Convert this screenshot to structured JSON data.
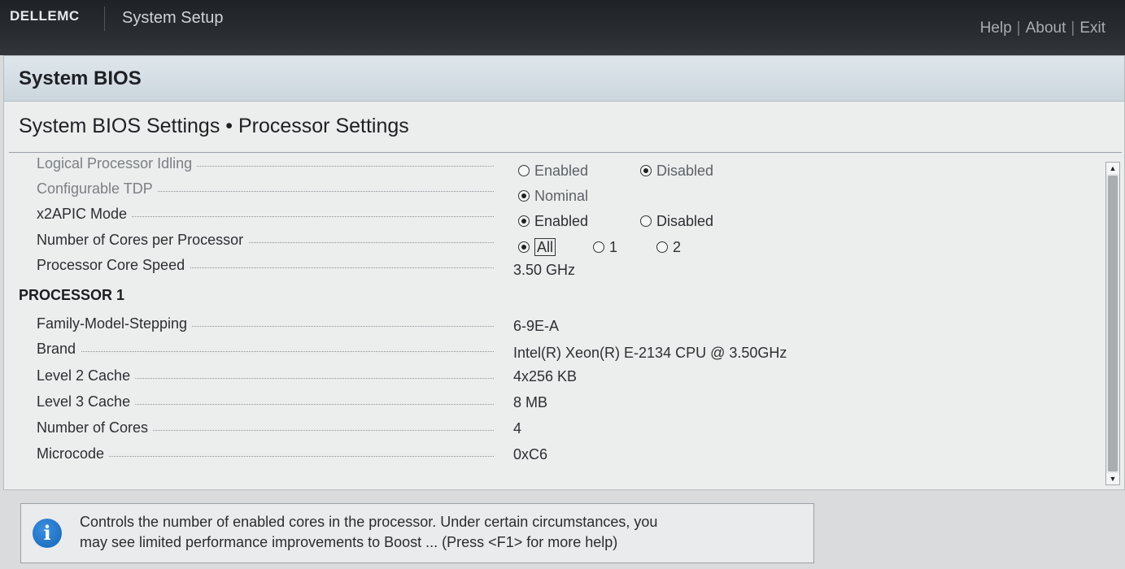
{
  "header": {
    "brand": "DELLEMC",
    "app_title": "System Setup",
    "links": [
      "Help",
      "About",
      "Exit"
    ]
  },
  "section": {
    "title": "System BIOS"
  },
  "page": {
    "title": "System BIOS Settings • Processor Settings"
  },
  "settings": [
    {
      "label": "Logical Processor Idling",
      "dim": true,
      "options": [
        "Enabled",
        "Disabled"
      ],
      "selected": "Disabled"
    },
    {
      "label": "Configurable TDP",
      "dim": true,
      "options": [
        "Nominal"
      ],
      "selected": "Nominal"
    },
    {
      "label": "x2APIC Mode",
      "dim": false,
      "options": [
        "Enabled",
        "Disabled"
      ],
      "selected": "Enabled"
    },
    {
      "label": "Number of Cores per Processor",
      "dim": false,
      "options": [
        "All",
        "1",
        "2"
      ],
      "selected": "All"
    },
    {
      "label": "Processor Core Speed",
      "dim": false,
      "value": "3.50 GHz"
    }
  ],
  "processor_heading": "PROCESSOR 1",
  "processor_info": [
    {
      "label": "Family-Model-Stepping",
      "value": "6-9E-A"
    },
    {
      "label": "Brand",
      "value": "Intel(R) Xeon(R) E-2134 CPU @ 3.50GHz"
    },
    {
      "label": "Level 2 Cache",
      "value": "4x256 KB"
    },
    {
      "label": "Level 3 Cache",
      "value": "8 MB"
    },
    {
      "label": "Number of Cores",
      "value": "4"
    },
    {
      "label": "Microcode",
      "value": "0xC6"
    }
  ],
  "help": {
    "icon": "info-icon",
    "line1": "Controls the number of enabled cores in the processor. Under certain circumstances, you",
    "line2": "may see limited performance improvements to Boost ... (Press <F1> for more help)"
  }
}
